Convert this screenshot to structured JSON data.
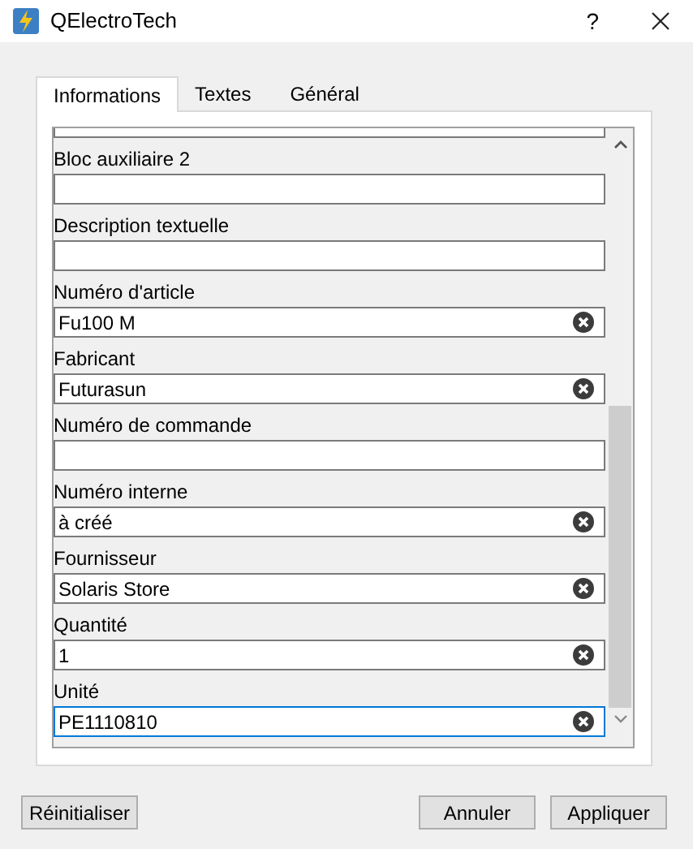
{
  "window": {
    "title": "QElectroTech",
    "help": "?"
  },
  "tabs": [
    {
      "label": "Informations",
      "selected": true
    },
    {
      "label": "Textes",
      "selected": false
    },
    {
      "label": "Général",
      "selected": false
    }
  ],
  "fields": [
    {
      "label": "Bloc auxiliaire 2",
      "focused": false
    },
    {
      "label": "Description textuelle",
      "focused": false
    },
    {
      "label": "Numéro d'article",
      "value": "Fu100 M",
      "focused": false
    },
    {
      "label": "Fabricant",
      "value": "Futurasun",
      "focused": false
    },
    {
      "label": "Numéro de commande",
      "focused": false
    },
    {
      "label": "Numéro interne",
      "value": "à créé",
      "focused": false
    },
    {
      "label": "Fournisseur",
      "value": "Solaris Store",
      "focused": false
    },
    {
      "label": "Quantité",
      "value": "1",
      "focused": false
    },
    {
      "label": "Unité",
      "value": "PE1110810",
      "focused": true
    }
  ],
  "buttons": [
    {
      "label": "Réinitialiser",
      "kind": "left"
    },
    {
      "label": "Annuler",
      "kind": "right"
    },
    {
      "label": "Appliquer",
      "kind": "right"
    }
  ]
}
